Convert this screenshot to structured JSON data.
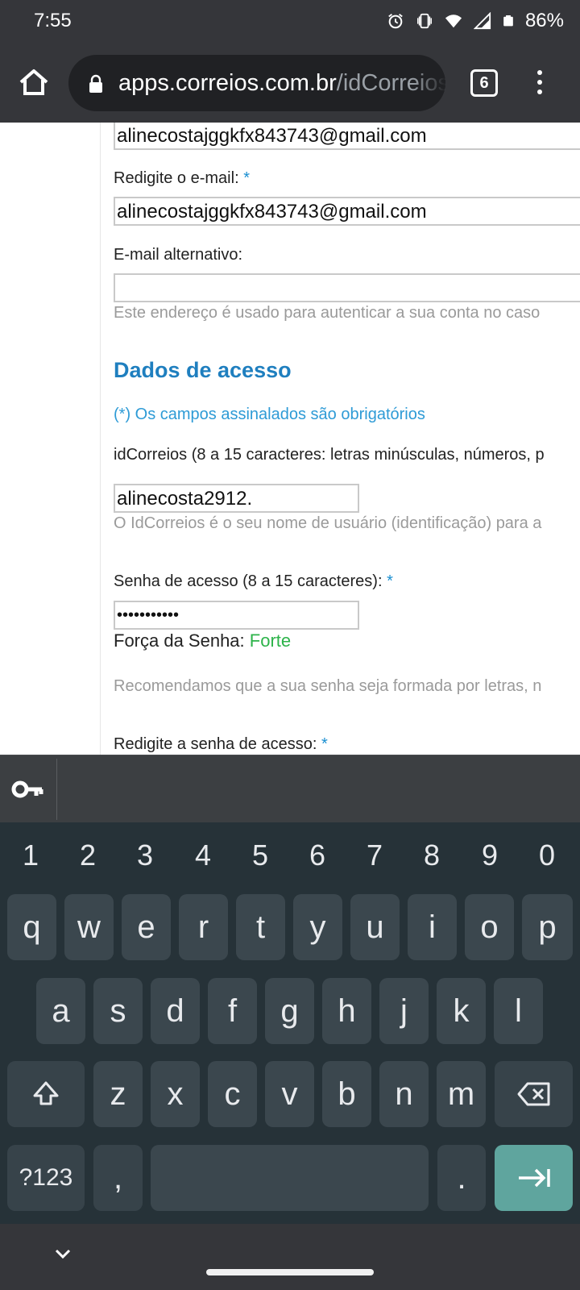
{
  "status_bar": {
    "time": "7:55",
    "battery": "86%",
    "icons": [
      "alarm-icon",
      "vibrate-icon",
      "wifi-icon",
      "signal-icon",
      "battery-icon"
    ]
  },
  "browser": {
    "url_host": "apps.correios.com.br",
    "url_path": "/idCorreios",
    "tab_count": "6",
    "icons": [
      "home-icon",
      "lock-icon",
      "tabs-icon",
      "menu-icon"
    ]
  },
  "form": {
    "email_value": "alinecostajggkfx843743@gmail.com",
    "confirm_email_label": "Redigite o e-mail:",
    "confirm_email_value": "alinecostajggkfx843743@gmail.com",
    "alt_email_label": "E-mail alternativo:",
    "alt_email_value": "",
    "alt_email_hint": "Este endereço é usado para autenticar a sua conta no caso",
    "section_title": "Dados de acesso",
    "mandatory_note": "(*) Os campos assinalados são obrigatórios",
    "idcorreios_label": "idCorreios (8 a 15 caracteres: letras minúsculas, números, p",
    "idcorreios_value": "alinecosta2912.",
    "idcorreios_hint": "O IdCorreios é o seu nome de usuário (identificação) para a",
    "password_label": "Senha de acesso (8 a 15 caracteres):",
    "password_value": "•••••••••••",
    "strength_label": "Força da Senha:",
    "strength_value": "Forte",
    "password_hint": "Recomendamos que a sua senha seja formada por letras, n",
    "confirm_password_label": "Redigite a senha de acesso:",
    "required_mark": "*"
  },
  "keyboard": {
    "numbers": [
      "1",
      "2",
      "3",
      "4",
      "5",
      "6",
      "7",
      "8",
      "9",
      "0"
    ],
    "row1": [
      "q",
      "w",
      "e",
      "r",
      "t",
      "y",
      "u",
      "i",
      "o",
      "p"
    ],
    "row2": [
      "a",
      "s",
      "d",
      "f",
      "g",
      "h",
      "j",
      "k",
      "l"
    ],
    "row3": [
      "z",
      "x",
      "c",
      "v",
      "b",
      "n",
      "m"
    ],
    "symbols_key": "?123",
    "comma_key": ",",
    "period_key": ".",
    "colors": {
      "background": "#263238",
      "key": "#3b474e",
      "action": "#5fa59e"
    }
  },
  "colors": {
    "section_title": "#1f7fbf",
    "required": "#1a8fd1",
    "strength_strong": "#2db34a",
    "hint": "#9a9a9a"
  }
}
